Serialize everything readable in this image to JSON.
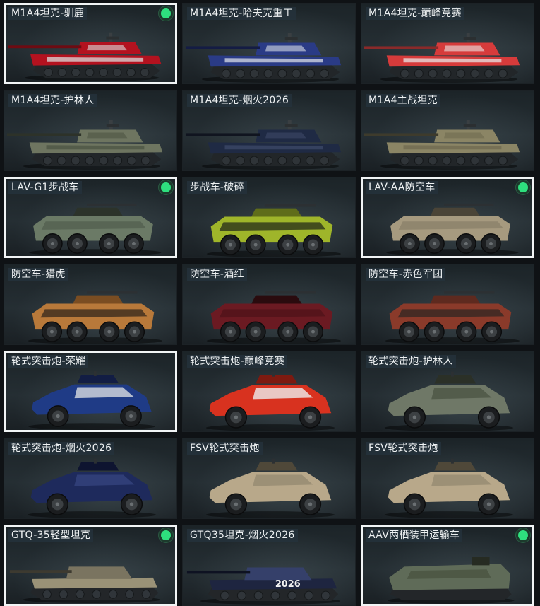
{
  "vehicles": [
    {
      "label": "M1A4坦克-驯鹿",
      "type": "tank",
      "selected": true,
      "owned": true,
      "colors": [
        "#b3121f",
        "#d9dcdc",
        "#6e0b12"
      ]
    },
    {
      "label": "M1A4坦克-哈夫克重工",
      "type": "tank",
      "selected": false,
      "owned": false,
      "colors": [
        "#2a3b86",
        "#d9dde6",
        "#141c44"
      ]
    },
    {
      "label": "M1A4坦克-巅峰竞赛",
      "type": "tank",
      "selected": false,
      "owned": false,
      "colors": [
        "#d63b3b",
        "#e7e7e7",
        "#8a2a2a"
      ]
    },
    {
      "label": "M1A4坦克-护林人",
      "type": "tank",
      "selected": false,
      "owned": false,
      "colors": [
        "#6e7560",
        "#4c5443",
        "#2d3229"
      ]
    },
    {
      "label": "M1A4坦克-烟火2026",
      "type": "tank",
      "selected": false,
      "owned": false,
      "colors": [
        "#1f2a44",
        "#3d4a68",
        "#10141f"
      ]
    },
    {
      "label": "M1A4主战坦克",
      "type": "tank",
      "selected": false,
      "owned": false,
      "colors": [
        "#8b8565",
        "#6f6a50",
        "#3e3b2c"
      ]
    },
    {
      "label": "LAV-G1步战车",
      "type": "lav",
      "selected": true,
      "owned": true,
      "colors": [
        "#6b7a66",
        "#505c4d",
        "#2c332a"
      ]
    },
    {
      "label": "步战车-破碎",
      "type": "lav",
      "selected": false,
      "owned": false,
      "colors": [
        "#9fb52a",
        "#1d2118",
        "#5f6d1a"
      ]
    },
    {
      "label": "LAV-AA防空车",
      "type": "lav",
      "selected": true,
      "owned": true,
      "colors": [
        "#a69a7f",
        "#877d66",
        "#4a4437"
      ]
    },
    {
      "label": "防空车-猎虎",
      "type": "lav",
      "selected": false,
      "owned": false,
      "colors": [
        "#b8793a",
        "#2a2119",
        "#7a4d22"
      ]
    },
    {
      "label": "防空车-酒红",
      "type": "lav",
      "selected": false,
      "owned": false,
      "colors": [
        "#6b1a22",
        "#4d1218",
        "#2a0b0e"
      ]
    },
    {
      "label": "防空车-赤色军团",
      "type": "lav",
      "selected": false,
      "owned": false,
      "colors": [
        "#8a3a2a",
        "#2a2522",
        "#5e2a1f"
      ]
    },
    {
      "label": "轮式突击炮-荣耀",
      "type": "assault",
      "selected": true,
      "owned": false,
      "colors": [
        "#1f3b86",
        "#d8dce0",
        "#121d44"
      ]
    },
    {
      "label": "轮式突击炮-巅峰竞赛",
      "type": "assault",
      "selected": false,
      "owned": false,
      "colors": [
        "#d8321f",
        "#eeeeee",
        "#7d1a10"
      ]
    },
    {
      "label": "轮式突击炮-护林人",
      "type": "assault",
      "selected": false,
      "owned": false,
      "colors": [
        "#6f7867",
        "#4c5545",
        "#2b3027"
      ]
    },
    {
      "label": "轮式突击炮-烟火2026",
      "type": "assault",
      "selected": false,
      "owned": false,
      "colors": [
        "#1e2a5c",
        "#34437e",
        "#0e1430"
      ]
    },
    {
      "label": "FSV轮式突击炮",
      "type": "assault",
      "selected": false,
      "owned": false,
      "colors": [
        "#b8a88a",
        "#958a70",
        "#4f4839"
      ]
    },
    {
      "label": "FSV轮式突击炮",
      "type": "assault",
      "selected": false,
      "owned": false,
      "colors": [
        "#b8a88a",
        "#958a70",
        "#4f4839"
      ]
    },
    {
      "label": "GTQ-35轻型坦克",
      "type": "light",
      "selected": true,
      "owned": true,
      "colors": [
        "#9a9277",
        "#7a7460",
        "#3d3a30"
      ]
    },
    {
      "label": "GTQ35坦克-烟火2026",
      "type": "light",
      "selected": false,
      "owned": false,
      "colors": [
        "#1e2540",
        "#35406a",
        "#0e1222"
      ],
      "decal": "2026"
    },
    {
      "label": "AAV两栖装甲运输车",
      "type": "aav",
      "selected": true,
      "owned": true,
      "colors": [
        "#5f6b58",
        "#48523f",
        "#262b22"
      ]
    }
  ],
  "ui": {
    "owned_badge_color": "#2ee07e",
    "selected_border_color": "#f1f4f5"
  }
}
